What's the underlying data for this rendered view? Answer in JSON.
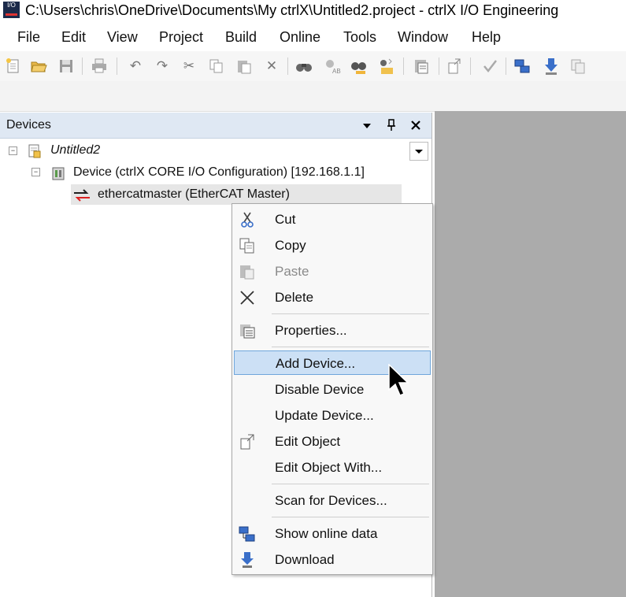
{
  "window": {
    "title": "C:\\Users\\chris\\OneDrive\\Documents\\My ctrlX\\Untitled2.project - ctrlX I/O Engineering",
    "app_icon_text": "I/O"
  },
  "menubar": {
    "items": [
      "File",
      "Edit",
      "View",
      "Project",
      "Build",
      "Online",
      "Tools",
      "Window",
      "Help"
    ]
  },
  "toolbar": {
    "buttons": [
      "new-project",
      "open-project",
      "save",
      "print",
      "undo",
      "redo",
      "cut",
      "copy",
      "paste",
      "delete",
      "find",
      "find-replace",
      "browse",
      "bookmark",
      "properties",
      "edit-object",
      "check",
      "online-config",
      "download",
      "multiple-download"
    ]
  },
  "devices_panel": {
    "title": "Devices",
    "header_buttons": [
      "dropdown-arrow",
      "pin",
      "close"
    ],
    "tree": {
      "root": "Untitled2",
      "device": "Device (ctrlX CORE I/O Configuration) [192.168.1.1]",
      "child": "ethercatmaster (EtherCAT Master)"
    }
  },
  "context_menu": {
    "items": [
      {
        "label": "Cut",
        "icon": "scissors-icon",
        "enabled": true
      },
      {
        "label": "Copy",
        "icon": "copy-icon",
        "enabled": true
      },
      {
        "label": "Paste",
        "icon": "paste-icon",
        "enabled": false
      },
      {
        "label": "Delete",
        "icon": "delete-x-icon",
        "enabled": true
      },
      {
        "label": "Properties...",
        "icon": "properties-icon",
        "enabled": true
      },
      {
        "label": "Add Device...",
        "icon": "",
        "enabled": true,
        "highlighted": true
      },
      {
        "label": "Disable Device",
        "icon": "",
        "enabled": true
      },
      {
        "label": "Update Device...",
        "icon": "",
        "enabled": true
      },
      {
        "label": "Edit Object",
        "icon": "edit-object-icon",
        "enabled": true
      },
      {
        "label": "Edit Object With...",
        "icon": "",
        "enabled": true
      },
      {
        "label": "Scan for Devices...",
        "icon": "",
        "enabled": true
      },
      {
        "label": "Show online data",
        "icon": "online-data-icon",
        "enabled": true
      },
      {
        "label": "Download",
        "icon": "download-icon",
        "enabled": true
      }
    ]
  },
  "colors": {
    "panel_header": "#dfe8f3",
    "highlight": "#cce0f5",
    "workspace_gray": "#ababab"
  }
}
